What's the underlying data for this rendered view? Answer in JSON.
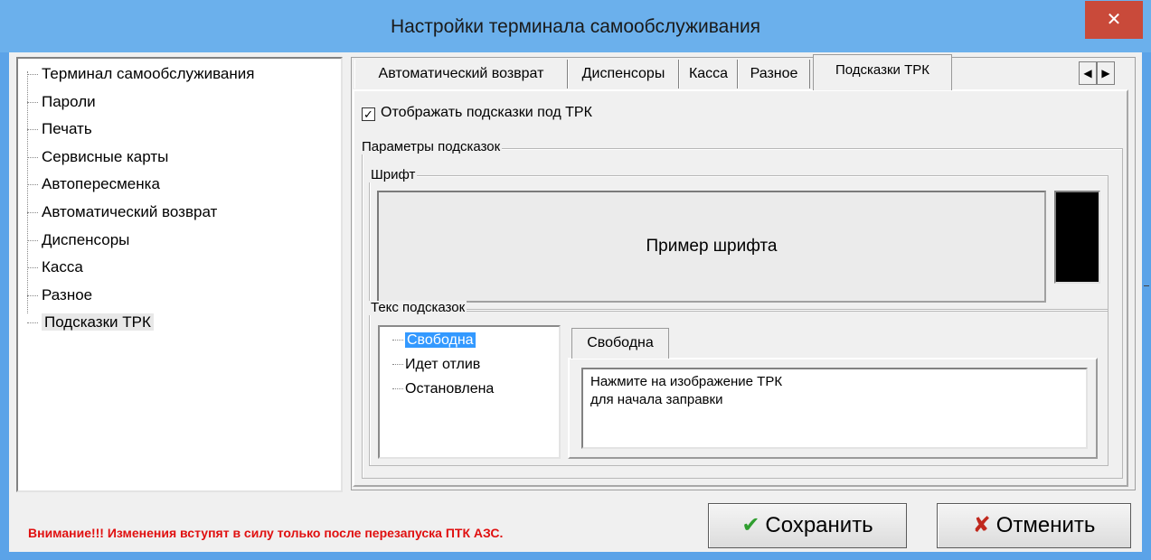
{
  "window": {
    "title": "Настройки терминала самообслуживания",
    "close_glyph": "✕"
  },
  "left_tree": {
    "items": [
      {
        "label": "Терминал самообслуживания"
      },
      {
        "label": "Пароли"
      },
      {
        "label": "Печать"
      },
      {
        "label": "Сервисные карты"
      },
      {
        "label": "Автопересменка"
      },
      {
        "label": "Автоматический возврат"
      },
      {
        "label": "Диспенсоры"
      },
      {
        "label": "Касса"
      },
      {
        "label": "Разное"
      },
      {
        "label": "Подсказки ТРК",
        "selected": true
      }
    ]
  },
  "tabs": {
    "items": [
      {
        "label": "Автоматический возврат"
      },
      {
        "label": "Диспенсоры"
      },
      {
        "label": "Касса"
      },
      {
        "label": "Разное"
      },
      {
        "label": "Подсказки ТРК",
        "active": true
      }
    ],
    "scroll_left": "◀",
    "scroll_right": "▶"
  },
  "hints_page": {
    "show_hints_checkbox": {
      "label": "Отображать подсказки под ТРК",
      "checked": true,
      "mark": "✓"
    },
    "params_group_label": "Параметры подсказок",
    "font_group_label": "Шрифт",
    "font_sample": "Пример шрифта",
    "font_color": "#000000",
    "text_group_label": "Текс подсказок",
    "hint_tree": [
      {
        "label": "Свободна",
        "selected": true
      },
      {
        "label": "Идет отлив"
      },
      {
        "label": "Остановлена"
      }
    ],
    "inner_tab_label": "Свободна",
    "hint_text": "Нажмите на изображение ТРК\nдля начала заправки"
  },
  "footer": {
    "warning": "Внимание!!! Изменения вступят в силу  только после перезапуска ПТК АЗС.",
    "save_icon": "✔",
    "save_label": "Сохранить",
    "cancel_icon": "✘",
    "cancel_label": "Отменить"
  },
  "colors": {
    "titlebar": "#6bb0ec",
    "close_button": "#c94a3a",
    "warning_text": "#e01010",
    "selection": "#3399ff",
    "save_icon": "#2f9e2f",
    "cancel_icon": "#c0281d"
  }
}
